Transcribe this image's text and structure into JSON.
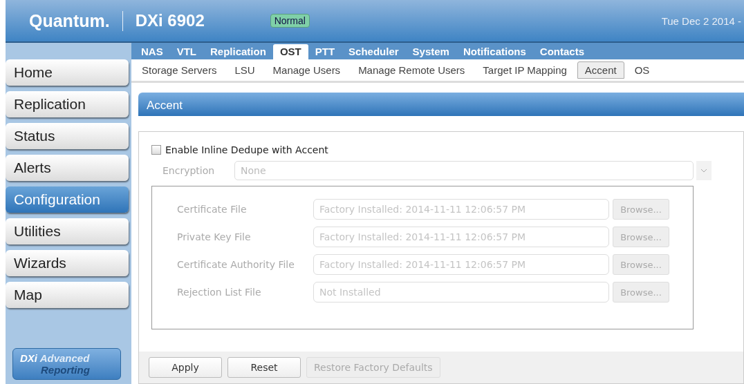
{
  "header": {
    "brand": "Quantum.",
    "model": "DXi 6902",
    "status": "Normal",
    "datetime": "Tue Dec 2 2014 -"
  },
  "top_tabs": [
    {
      "label": "NAS",
      "selected": false
    },
    {
      "label": "VTL",
      "selected": false
    },
    {
      "label": "Replication",
      "selected": false
    },
    {
      "label": "OST",
      "selected": true
    },
    {
      "label": "PTT",
      "selected": false
    },
    {
      "label": "Scheduler",
      "selected": false
    },
    {
      "label": "System",
      "selected": false
    },
    {
      "label": "Notifications",
      "selected": false
    },
    {
      "label": "Contacts",
      "selected": false
    }
  ],
  "sub_tabs": [
    {
      "label": "Storage Servers",
      "selected": false
    },
    {
      "label": "LSU",
      "selected": false
    },
    {
      "label": "Manage Users",
      "selected": false
    },
    {
      "label": "Manage Remote Users",
      "selected": false
    },
    {
      "label": "Target IP Mapping",
      "selected": false
    },
    {
      "label": "Accent",
      "selected": true
    },
    {
      "label": "OS",
      "selected": false
    }
  ],
  "sidebar": {
    "items": [
      {
        "label": "Home",
        "selected": false
      },
      {
        "label": "Replication",
        "selected": false
      },
      {
        "label": "Status",
        "selected": false
      },
      {
        "label": "Alerts",
        "selected": false
      },
      {
        "label": "Configuration",
        "selected": true
      },
      {
        "label": "Utilities",
        "selected": false
      },
      {
        "label": "Wizards",
        "selected": false
      },
      {
        "label": "Map",
        "selected": false
      }
    ],
    "reporting": {
      "line1a": "DXi",
      "line1b": "Advanced",
      "line2": "Reporting"
    }
  },
  "panel": {
    "title": "Accent",
    "enable": {
      "label": "Enable Inline Dedupe with Accent",
      "checked": false
    },
    "encryption": {
      "label": "Encryption",
      "value": "None",
      "disabled": true
    },
    "files": [
      {
        "label": "Certificate File",
        "value": "Factory Installed: 2014-11-11 12:06:57 PM",
        "button": "Browse...",
        "disabled": true
      },
      {
        "label": "Private Key File",
        "value": "Factory Installed: 2014-11-11 12:06:57 PM",
        "button": "Browse...",
        "disabled": true
      },
      {
        "label": "Certificate Authority File",
        "value": "Factory Installed: 2014-11-11 12:06:57 PM",
        "button": "Browse...",
        "disabled": true
      },
      {
        "label": "Rejection List File",
        "value": "Not Installed",
        "button": "Browse...",
        "disabled": true
      }
    ],
    "buttons": [
      {
        "label": "Apply",
        "disabled": false
      },
      {
        "label": "Reset",
        "disabled": false
      },
      {
        "label": "Restore Factory Defaults",
        "disabled": true
      }
    ]
  }
}
